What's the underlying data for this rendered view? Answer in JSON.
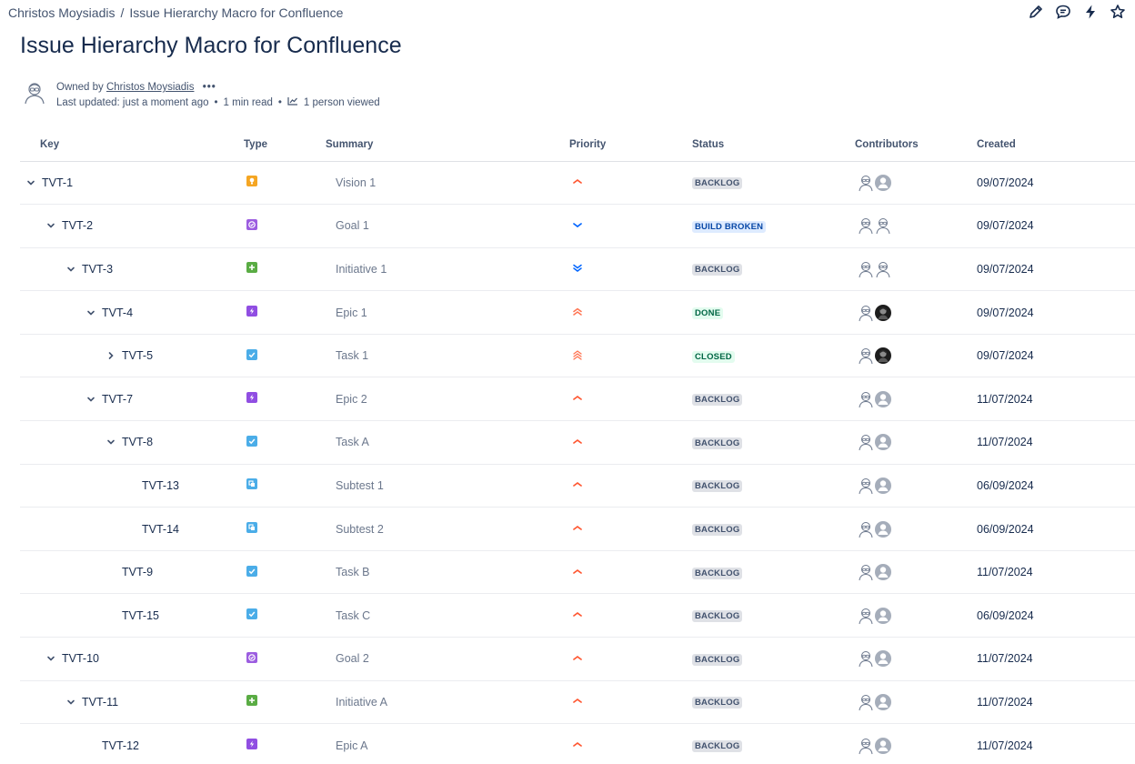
{
  "breadcrumb": {
    "owner": "Christos Moysiadis",
    "separator": "/",
    "page": "Issue Hierarchy Macro for Confluence"
  },
  "title": "Issue Hierarchy Macro for Confluence",
  "byline": {
    "owned_by_label": "Owned by",
    "owner": "Christos Moysiadis",
    "more": "•••",
    "last_updated": "Last updated: just a moment ago",
    "read_time": "1 min read",
    "views": "1 person viewed"
  },
  "columns": {
    "key": "Key",
    "type": "Type",
    "summary": "Summary",
    "priority": "Priority",
    "status": "Status",
    "contributors": "Contributors",
    "created": "Created"
  },
  "type_colors": {
    "vision": "#f5a623",
    "goal": "#9c5de0",
    "initiative": "#5aac44",
    "epic": "#904ee2",
    "task": "#4bade8",
    "subtask": "#4bade8"
  },
  "status_styles": {
    "BACKLOG": {
      "bg": "#dfe1e6",
      "fg": "#42526e"
    },
    "BUILD BROKEN": {
      "bg": "#deebff",
      "fg": "#0747a6"
    },
    "DONE": {
      "bg": "#e3fcef",
      "fg": "#006644"
    },
    "CLOSED": {
      "bg": "#e3fcef",
      "fg": "#006644"
    }
  },
  "rows": [
    {
      "key": "TVT-1",
      "level": 0,
      "expander": "down",
      "type": "vision",
      "summary": "Vision 1",
      "priority": "medium",
      "status": "BACKLOG",
      "contributors": [
        "outline",
        "gray"
      ],
      "created": "09/07/2024"
    },
    {
      "key": "TVT-2",
      "level": 1,
      "expander": "down",
      "type": "goal",
      "summary": "Goal 1",
      "priority": "low",
      "status": "BUILD BROKEN",
      "contributors": [
        "outline",
        "outline"
      ],
      "created": "09/07/2024"
    },
    {
      "key": "TVT-3",
      "level": 2,
      "expander": "down",
      "type": "initiative",
      "summary": "Initiative 1",
      "priority": "lowest",
      "status": "BACKLOG",
      "contributors": [
        "outline",
        "outline"
      ],
      "created": "09/07/2024"
    },
    {
      "key": "TVT-4",
      "level": 3,
      "expander": "down",
      "type": "epic",
      "summary": "Epic 1",
      "priority": "high",
      "status": "DONE",
      "contributors": [
        "outline",
        "photo"
      ],
      "created": "09/07/2024"
    },
    {
      "key": "TVT-5",
      "level": 4,
      "expander": "right",
      "type": "task",
      "summary": "Task 1",
      "priority": "highest",
      "status": "CLOSED",
      "contributors": [
        "outline",
        "photo"
      ],
      "created": "09/07/2024"
    },
    {
      "key": "TVT-7",
      "level": 3,
      "expander": "down",
      "type": "epic",
      "summary": "Epic 2",
      "priority": "medium",
      "status": "BACKLOG",
      "contributors": [
        "outline",
        "gray"
      ],
      "created": "11/07/2024"
    },
    {
      "key": "TVT-8",
      "level": 4,
      "expander": "down",
      "type": "task",
      "summary": "Task A",
      "priority": "medium",
      "status": "BACKLOG",
      "contributors": [
        "outline",
        "gray"
      ],
      "created": "11/07/2024"
    },
    {
      "key": "TVT-13",
      "level": 5,
      "expander": "none",
      "type": "subtask",
      "summary": "Subtest 1",
      "priority": "medium",
      "status": "BACKLOG",
      "contributors": [
        "outline",
        "gray"
      ],
      "created": "06/09/2024"
    },
    {
      "key": "TVT-14",
      "level": 5,
      "expander": "none",
      "type": "subtask",
      "summary": "Subtest 2",
      "priority": "medium",
      "status": "BACKLOG",
      "contributors": [
        "outline",
        "gray"
      ],
      "created": "06/09/2024"
    },
    {
      "key": "TVT-9",
      "level": 4,
      "expander": "none",
      "type": "task",
      "summary": "Task B",
      "priority": "medium",
      "status": "BACKLOG",
      "contributors": [
        "outline",
        "gray"
      ],
      "created": "11/07/2024"
    },
    {
      "key": "TVT-15",
      "level": 4,
      "expander": "none",
      "type": "task",
      "summary": "Task C",
      "priority": "medium",
      "status": "BACKLOG",
      "contributors": [
        "outline",
        "gray"
      ],
      "created": "06/09/2024"
    },
    {
      "key": "TVT-10",
      "level": 1,
      "expander": "down",
      "type": "goal",
      "summary": "Goal 2",
      "priority": "medium",
      "status": "BACKLOG",
      "contributors": [
        "outline",
        "gray"
      ],
      "created": "11/07/2024"
    },
    {
      "key": "TVT-11",
      "level": 2,
      "expander": "down",
      "type": "initiative",
      "summary": "Initiative A",
      "priority": "medium",
      "status": "BACKLOG",
      "contributors": [
        "outline",
        "gray"
      ],
      "created": "11/07/2024"
    },
    {
      "key": "TVT-12",
      "level": 3,
      "expander": "none",
      "type": "epic",
      "summary": "Epic A",
      "priority": "medium",
      "status": "BACKLOG",
      "contributors": [
        "outline",
        "gray"
      ],
      "created": "11/07/2024"
    }
  ]
}
